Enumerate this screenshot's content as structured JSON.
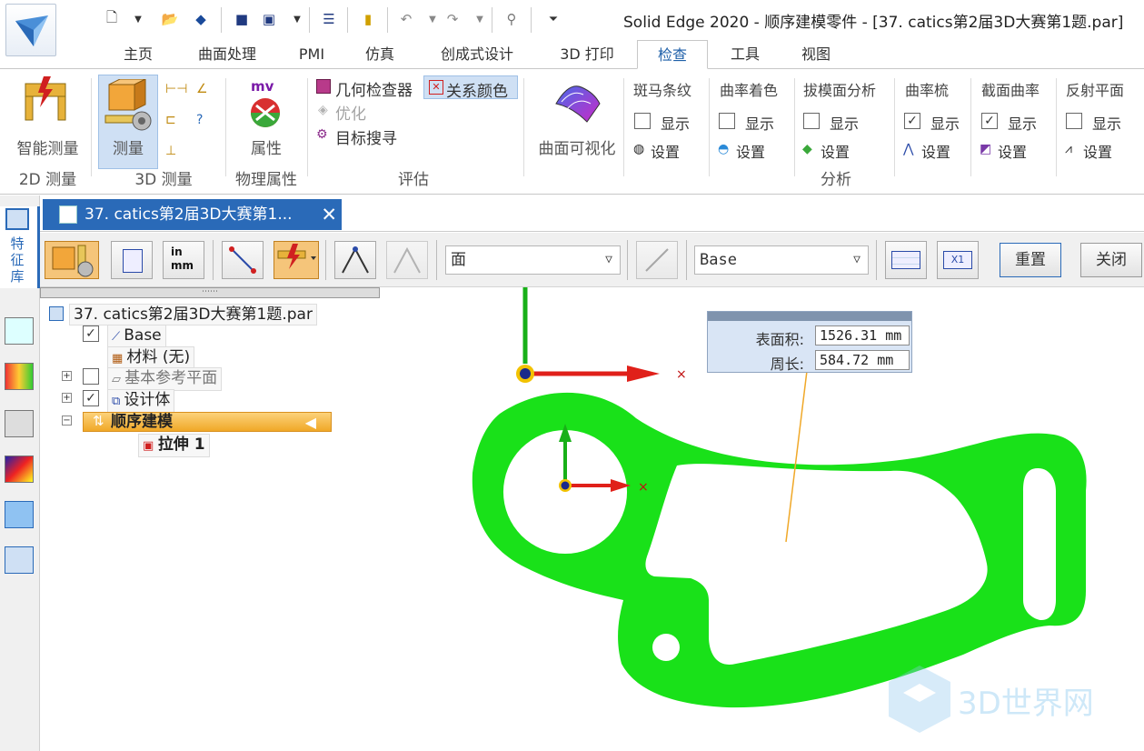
{
  "app": {
    "window_title": "Solid Edge 2020 - 顺序建模零件 - [37. catics第2届3D大赛第1题.par]"
  },
  "quick_access": [
    "new-icon",
    "dropdown-icon",
    "open-icon",
    "print-icon",
    "save-icon",
    "save-all-icon",
    "dropdown-icon",
    "properties-icon",
    "notebook-icon",
    "undo-icon",
    "dropdown-icon",
    "redo-icon",
    "dropdown-icon",
    "link-icon",
    "customize-icon"
  ],
  "tabs": [
    {
      "label": "主页"
    },
    {
      "label": "曲面处理"
    },
    {
      "label": "PMI"
    },
    {
      "label": "仿真"
    },
    {
      "label": "创成式设计"
    },
    {
      "label": "3D 打印"
    },
    {
      "label": "检查"
    },
    {
      "label": "工具"
    },
    {
      "label": "视图"
    }
  ],
  "active_tab": "检查",
  "ribbon": {
    "smart_measure": {
      "label": "智能测量",
      "group": "2D 测量"
    },
    "measure": {
      "label": "测量",
      "group": "3D 测量"
    },
    "properties": {
      "label": "属性",
      "group": "物理属性"
    },
    "evaluate": {
      "geometry_inspector": "几何检查器",
      "relationship_color": "关系颜色",
      "optimize": "优化",
      "target_search": "目标搜寻",
      "group": "评估"
    },
    "surface_visualization": {
      "label": "曲面可视化"
    },
    "analysis_group": "分析",
    "analysis": [
      {
        "title": "斑马条纹",
        "show": "显示",
        "settings": "设置",
        "checked": false
      },
      {
        "title": "曲率着色",
        "show": "显示",
        "settings": "设置",
        "checked": false
      },
      {
        "title": "拔模面分析",
        "show": "显示",
        "settings": "设置",
        "checked": false
      },
      {
        "title": "曲率梳",
        "show": "显示",
        "settings": "设置",
        "checked": true
      },
      {
        "title": "截面曲率",
        "show": "显示",
        "settings": "设置",
        "checked": true
      },
      {
        "title": "反射平面",
        "show": "显示",
        "settings": "设置",
        "checked": false
      }
    ]
  },
  "sidebar": {
    "label": "特征库"
  },
  "doc_tab": {
    "label": "37. catics第2届3D大赛第1..."
  },
  "measure_toolbar": {
    "face_combo": "面",
    "coord_combo": "Base",
    "reset": "重置",
    "close": "关闭"
  },
  "tree": {
    "root": "37. catics第2届3D大赛第1题.par",
    "items": [
      {
        "label": "Base",
        "checked": true
      },
      {
        "label": "材料 (无)"
      },
      {
        "label": "基本参考平面",
        "checked": false,
        "expander": "+"
      },
      {
        "label": "设计体",
        "checked": true,
        "expander": "+"
      },
      {
        "label": "顺序建模",
        "expander": "−"
      },
      {
        "label": "拉伸 1"
      }
    ]
  },
  "measurement": {
    "area_label": "表面积:",
    "area_value": "1526.31 mm",
    "perimeter_label": "周长:",
    "perimeter_value": "584.72 mm"
  },
  "watermark": "3D世界网",
  "colors": {
    "part": "#19e119",
    "accent_blue": "#2a6ab8",
    "axis_red": "#e0201a",
    "axis_green": "#18b018",
    "highlight": "#f5b63a"
  }
}
